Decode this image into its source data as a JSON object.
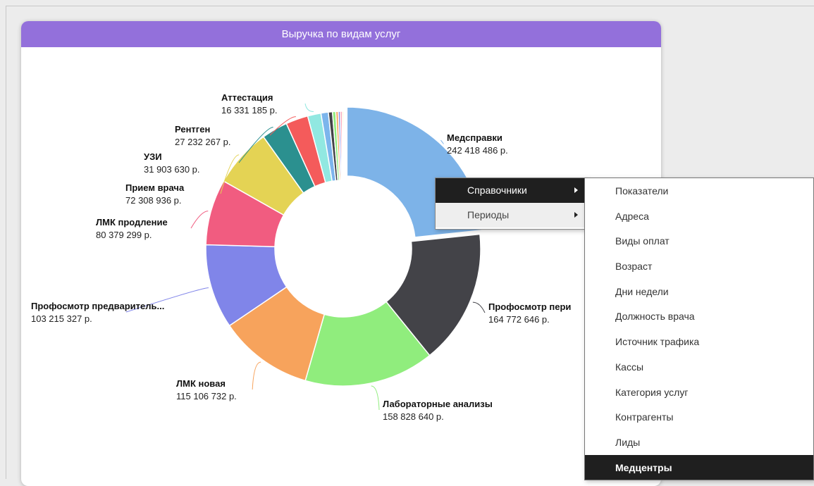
{
  "card": {
    "title": "Выручка по видам услуг"
  },
  "context_menu": {
    "items": [
      {
        "label": "Справочники",
        "active": true
      },
      {
        "label": "Периоды",
        "active": false
      }
    ]
  },
  "submenu": {
    "items": [
      {
        "label": "Показатели"
      },
      {
        "label": "Адреса"
      },
      {
        "label": "Виды оплат"
      },
      {
        "label": "Возраст"
      },
      {
        "label": "Дни недели"
      },
      {
        "label": "Должность врача"
      },
      {
        "label": "Источник трафика"
      },
      {
        "label": "Кассы"
      },
      {
        "label": "Категория услуг"
      },
      {
        "label": "Контрагенты"
      },
      {
        "label": "Лиды"
      },
      {
        "label": "Медцентры",
        "active": true
      }
    ]
  },
  "chart_data": {
    "type": "pie",
    "donut": true,
    "slices": [
      {
        "name": "Медсправки",
        "value_text": "242 418 486 р.",
        "value": 242418486,
        "color": "#7db3e8",
        "exploded": true
      },
      {
        "name": "Профосмотр пери",
        "value_text": "164 772 646 р.",
        "value": 164772646,
        "color": "#434348"
      },
      {
        "name": "Лабораторные анализы",
        "value_text": "158 828 640 р.",
        "value": 158828640,
        "color": "#90ed7d"
      },
      {
        "name": "ЛМК новая",
        "value_text": "115 106 732 р.",
        "value": 115106732,
        "color": "#f7a35c"
      },
      {
        "name": "Профосмотр предваритель...",
        "value_text": "103 215 327 р.",
        "value": 103215327,
        "color": "#8085e9"
      },
      {
        "name": "ЛМК продление",
        "value_text": "80 379 299 р.",
        "value": 80379299,
        "color": "#f15c80"
      },
      {
        "name": "Прием врача",
        "value_text": "72 308 936 р.",
        "value": 72308936,
        "color": "#e4d354"
      },
      {
        "name": "УЗИ",
        "value_text": "31 903 630 р.",
        "value": 31903630,
        "color": "#2b908f"
      },
      {
        "name": "Рентген",
        "value_text": "27 232 267 р.",
        "value": 27232267,
        "color": "#f45b5b"
      },
      {
        "name": "Аттестация",
        "value_text": "16 331 185 р.",
        "value": 16331185,
        "color": "#91e8e1"
      },
      {
        "name": "",
        "value": 9000000,
        "color": "#7cb5ec"
      },
      {
        "name": "",
        "value": 5000000,
        "color": "#434348"
      },
      {
        "name": "",
        "value": 4000000,
        "color": "#90ed7d"
      },
      {
        "name": "",
        "value": 3000000,
        "color": "#f7a35c"
      },
      {
        "name": "",
        "value": 2500000,
        "color": "#8085e9"
      },
      {
        "name": "",
        "value": 2000000,
        "color": "#f15c80"
      },
      {
        "name": "",
        "value": 1500000,
        "color": "#e4d354"
      }
    ]
  }
}
